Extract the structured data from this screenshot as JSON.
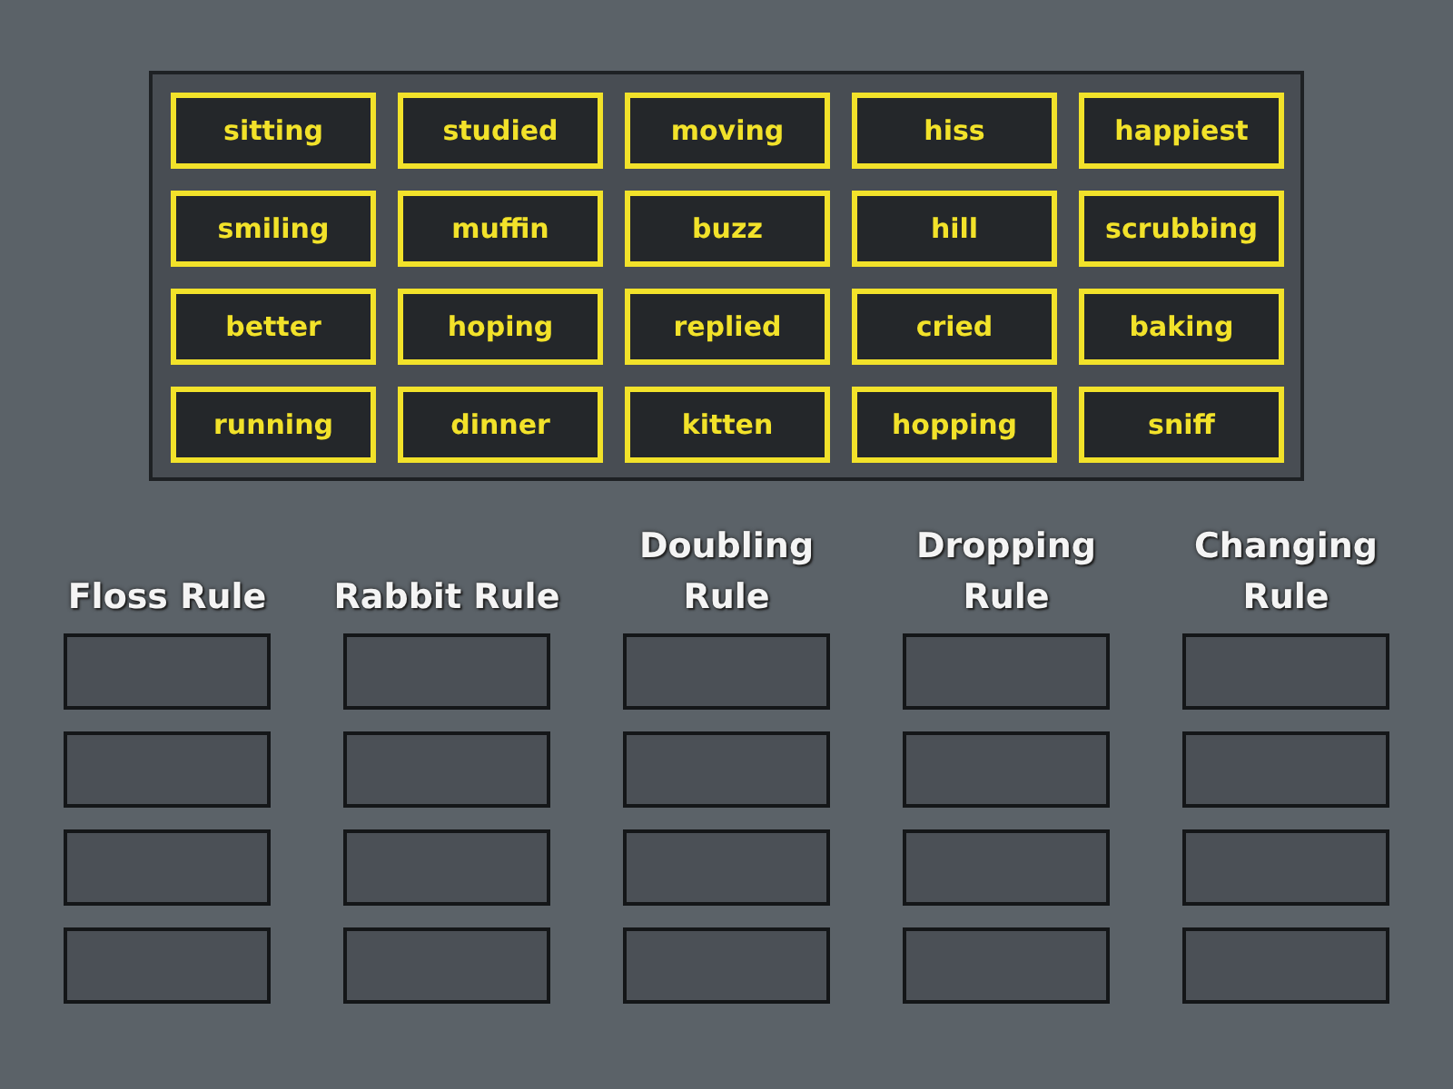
{
  "word_bank": [
    "sitting",
    "studied",
    "moving",
    "hiss",
    "happiest",
    "smiling",
    "muffin",
    "buzz",
    "hill",
    "scrubbing",
    "better",
    "hoping",
    "replied",
    "cried",
    "baking",
    "running",
    "dinner",
    "kitten",
    "hopping",
    "sniff"
  ],
  "categories": [
    {
      "title": "Floss Rule",
      "slots": [
        {
          "empty": true
        },
        {
          "empty": true
        },
        {
          "empty": true
        },
        {
          "empty": true
        }
      ]
    },
    {
      "title": "Rabbit Rule",
      "slots": [
        {
          "empty": true
        },
        {
          "empty": true
        },
        {
          "empty": true
        },
        {
          "empty": true
        }
      ]
    },
    {
      "title": "Doubling Rule",
      "slots": [
        {
          "empty": true
        },
        {
          "empty": true
        },
        {
          "empty": true
        },
        {
          "empty": true
        }
      ]
    },
    {
      "title": "Dropping Rule",
      "slots": [
        {
          "empty": true
        },
        {
          "empty": true
        },
        {
          "empty": true
        },
        {
          "empty": true
        }
      ]
    },
    {
      "title": "Changing Rule",
      "slots": [
        {
          "empty": true
        },
        {
          "empty": true
        },
        {
          "empty": true
        },
        {
          "empty": true
        }
      ]
    }
  ]
}
